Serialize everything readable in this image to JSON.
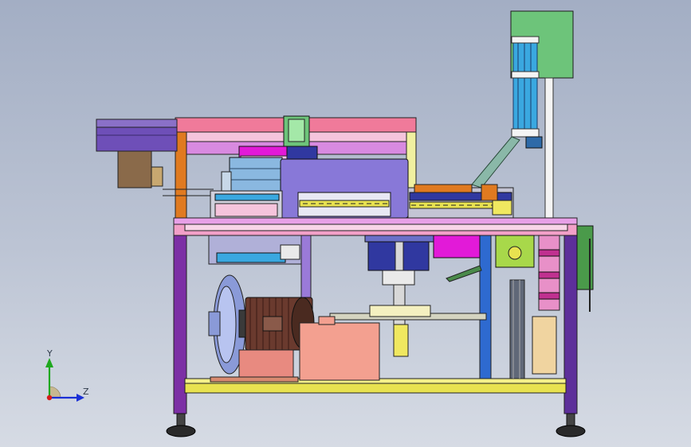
{
  "viewport": {
    "background_top": "#a3aec4",
    "background_bottom": "#d6dbe4"
  },
  "triad": {
    "y_label": "Y",
    "z_label": "Z",
    "y_color": "#1fa81f",
    "z_color": "#1a2fd6",
    "x_color": "#d61a1a"
  },
  "colors": {
    "frame_top": "#f2a0c8",
    "frame_leg": "#7c2fa5",
    "frame_leg_right": "#5d2f9a",
    "upper_frame": "#f07a9a",
    "orange_post": "#e07a20",
    "cylinder_blue": "#3aa8e0",
    "green_box": "#6dc47a",
    "motor_brown": "#6a3a2e",
    "pump_blue": "#8a9ad8",
    "salmon_block": "#f3a090",
    "yellow_rail": "#e8e250",
    "navy_block": "#3038a0",
    "magenta": "#e21ad8"
  }
}
